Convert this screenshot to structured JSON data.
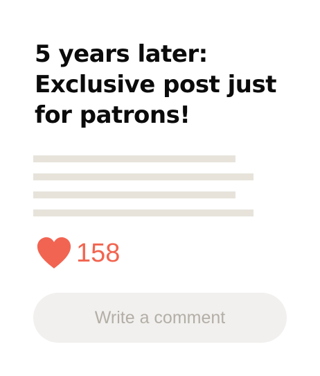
{
  "post": {
    "title": "5 years later: Exclusive post just for patrons!",
    "likes_count": "158"
  },
  "comment": {
    "placeholder": "Write a comment"
  },
  "icons": {
    "like": "heart-icon"
  },
  "colors": {
    "heart": "#f26452",
    "placeholder_lines": "#e7e3db",
    "comment_bg": "#f1f0ee"
  }
}
